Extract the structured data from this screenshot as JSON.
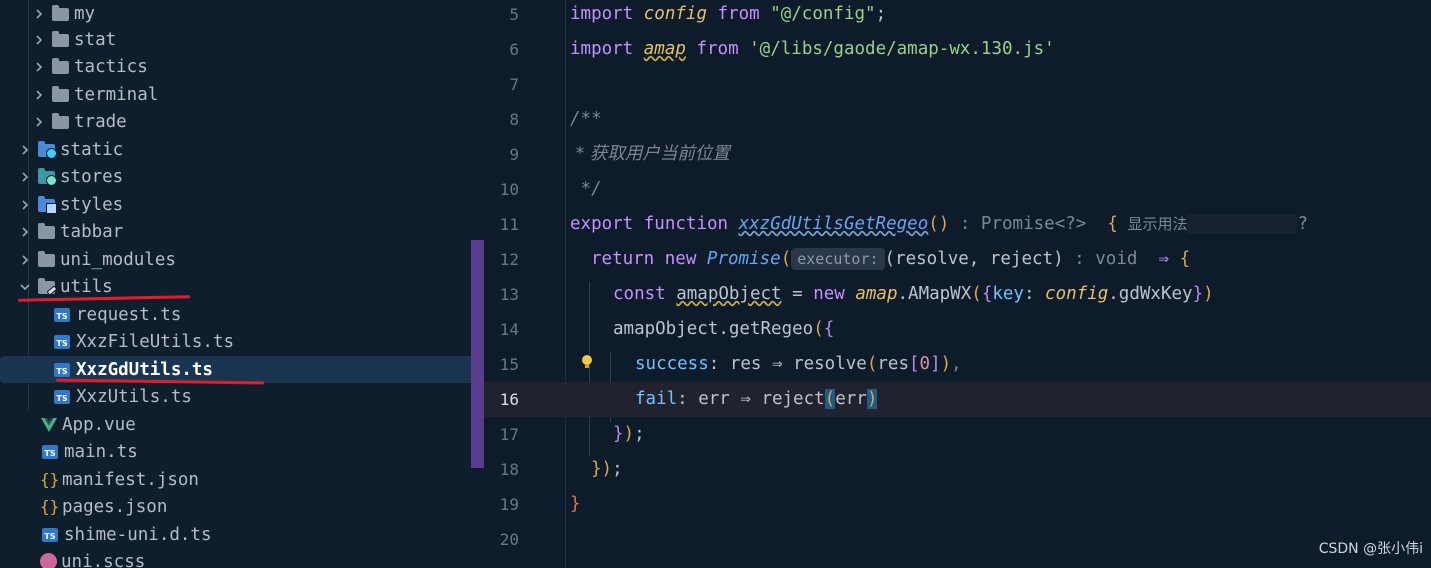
{
  "sidebar": {
    "items": [
      {
        "label": "my",
        "icon": "folder-icon"
      },
      {
        "label": "stat",
        "icon": "folder-icon"
      },
      {
        "label": "tactics",
        "icon": "folder-icon"
      },
      {
        "label": "terminal",
        "icon": "folder-icon"
      },
      {
        "label": "trade",
        "icon": "folder-icon"
      },
      {
        "label": "static",
        "icon": "folder-web-icon"
      },
      {
        "label": "stores",
        "icon": "folder-stores-icon"
      },
      {
        "label": "styles",
        "icon": "folder-styles-icon"
      },
      {
        "label": "tabbar",
        "icon": "folder-icon"
      },
      {
        "label": "uni_modules",
        "icon": "folder-icon"
      },
      {
        "label": "utils",
        "icon": "folder-utils-icon"
      },
      {
        "label": "request.ts",
        "icon": "ts-file-icon"
      },
      {
        "label": "XxzFileUtils.ts",
        "icon": "ts-file-icon"
      },
      {
        "label": "XxzGdUtils.ts",
        "icon": "ts-file-icon"
      },
      {
        "label": "XxzUtils.ts",
        "icon": "ts-file-icon"
      },
      {
        "label": "App.vue",
        "icon": "vue-file-icon"
      },
      {
        "label": "main.ts",
        "icon": "ts-file-icon"
      },
      {
        "label": "manifest.json",
        "icon": "json-file-icon"
      },
      {
        "label": "pages.json",
        "icon": "json-file-icon"
      },
      {
        "label": "shime-uni.d.ts",
        "icon": "ts-file-icon"
      },
      {
        "label": "uni.scss",
        "icon": "sass-file-icon"
      }
    ],
    "ts_badge": "TS",
    "json_glyph": "{}"
  },
  "editor": {
    "line_numbers": [
      "5",
      "6",
      "7",
      "8",
      "9",
      "10",
      "11",
      "12",
      "13",
      "14",
      "15",
      "16",
      "17",
      "18",
      "19",
      "20"
    ],
    "current_line": "16",
    "tokens": {
      "l5": [
        "import ",
        "config",
        " from ",
        "\"@/config\"",
        ";"
      ],
      "l6": [
        "import ",
        "amap",
        " from ",
        "'@/libs/gaode/amap-wx.130.js'"
      ],
      "l8": [
        "/**"
      ],
      "l9": [
        " * 获取用户当前位置"
      ],
      "l10": [
        " */"
      ],
      "l11": [
        "export ",
        "function ",
        "xxzGdUtilsGetRegeo",
        "()",
        " : Promise<?>",
        "  {",
        "  显示用法",
        "?"
      ],
      "l12": [
        "return ",
        "new ",
        "Promise",
        "(",
        "executor:",
        "(resolve, reject)",
        " : void",
        "  ⇒ ",
        "{"
      ],
      "l13": [
        "const ",
        "amapObject",
        " = ",
        "new ",
        "amap",
        ".AMapWX",
        "(",
        "{",
        "key",
        ": ",
        "config",
        ".gdWxKey",
        "}",
        ")"
      ],
      "l14": [
        "amapObject",
        ".getRegeo",
        "(",
        "{"
      ],
      "l15": [
        "success",
        ": res ⇒ ",
        "resolve",
        "(",
        "res",
        "[",
        "0",
        "]",
        ")",
        ","
      ],
      "l16": [
        "fail",
        ": err ⇒ ",
        "reject",
        "(",
        "err",
        ")"
      ],
      "l17": [
        "}",
        ")",
        ";"
      ],
      "l18": [
        "}",
        ")",
        ";"
      ],
      "l19": [
        "}"
      ]
    }
  },
  "watermark": "CSDN @张小伟i",
  "colors": {
    "background": "#0d1b2a",
    "keyword": "#c590ff",
    "string": "#9ad08a",
    "annotation": "#e11d2a"
  }
}
